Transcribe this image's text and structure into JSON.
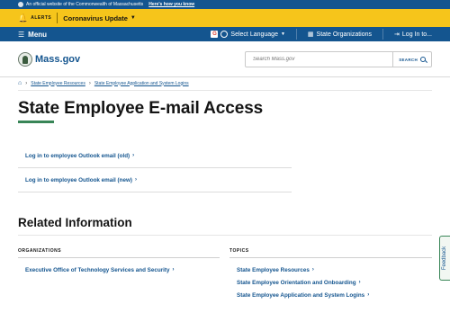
{
  "official_banner": {
    "text": "An official website of the Commonwealth of Massachusetts",
    "link": "Here's how you know"
  },
  "alerts": {
    "label": "ALERTS",
    "update": "Coronavirus Update"
  },
  "menubar": {
    "menu": "Menu",
    "language": "Select Language",
    "state_orgs": "State Organizations",
    "login": "Log In to..."
  },
  "header": {
    "logo_text": "Mass.gov",
    "search_placeholder": "Search Mass.gov",
    "search_button": "SEARCH"
  },
  "breadcrumbs": [
    "State Employee Resources",
    "State Employee Application and System Logins"
  ],
  "page_title": "State Employee E-mail Access",
  "links": [
    {
      "label": "Log in to employee Outlook email (old)"
    },
    {
      "label": "Log in to employee Outlook email (new)"
    }
  ],
  "related": {
    "heading": "Related Information",
    "organizations": {
      "header": "ORGANIZATIONS",
      "items": [
        "Executive Office of Technology Services and Security"
      ]
    },
    "topics": {
      "header": "TOPICS",
      "items": [
        "State Employee Resources",
        "State Employee Orientation and Onboarding",
        "State Employee Application and System Logins"
      ]
    }
  },
  "feedback": "Feedback",
  "colors": {
    "brand_blue": "#14558f",
    "alert_yellow": "#f6c51b",
    "accent_green": "#388557"
  },
  "icons": [
    "seal-icon",
    "bell-icon",
    "chevron-down-icon",
    "hamburger-icon",
    "google-icon",
    "globe-icon",
    "building-icon",
    "login-icon",
    "search-icon",
    "home-icon",
    "chevron-right-icon"
  ]
}
